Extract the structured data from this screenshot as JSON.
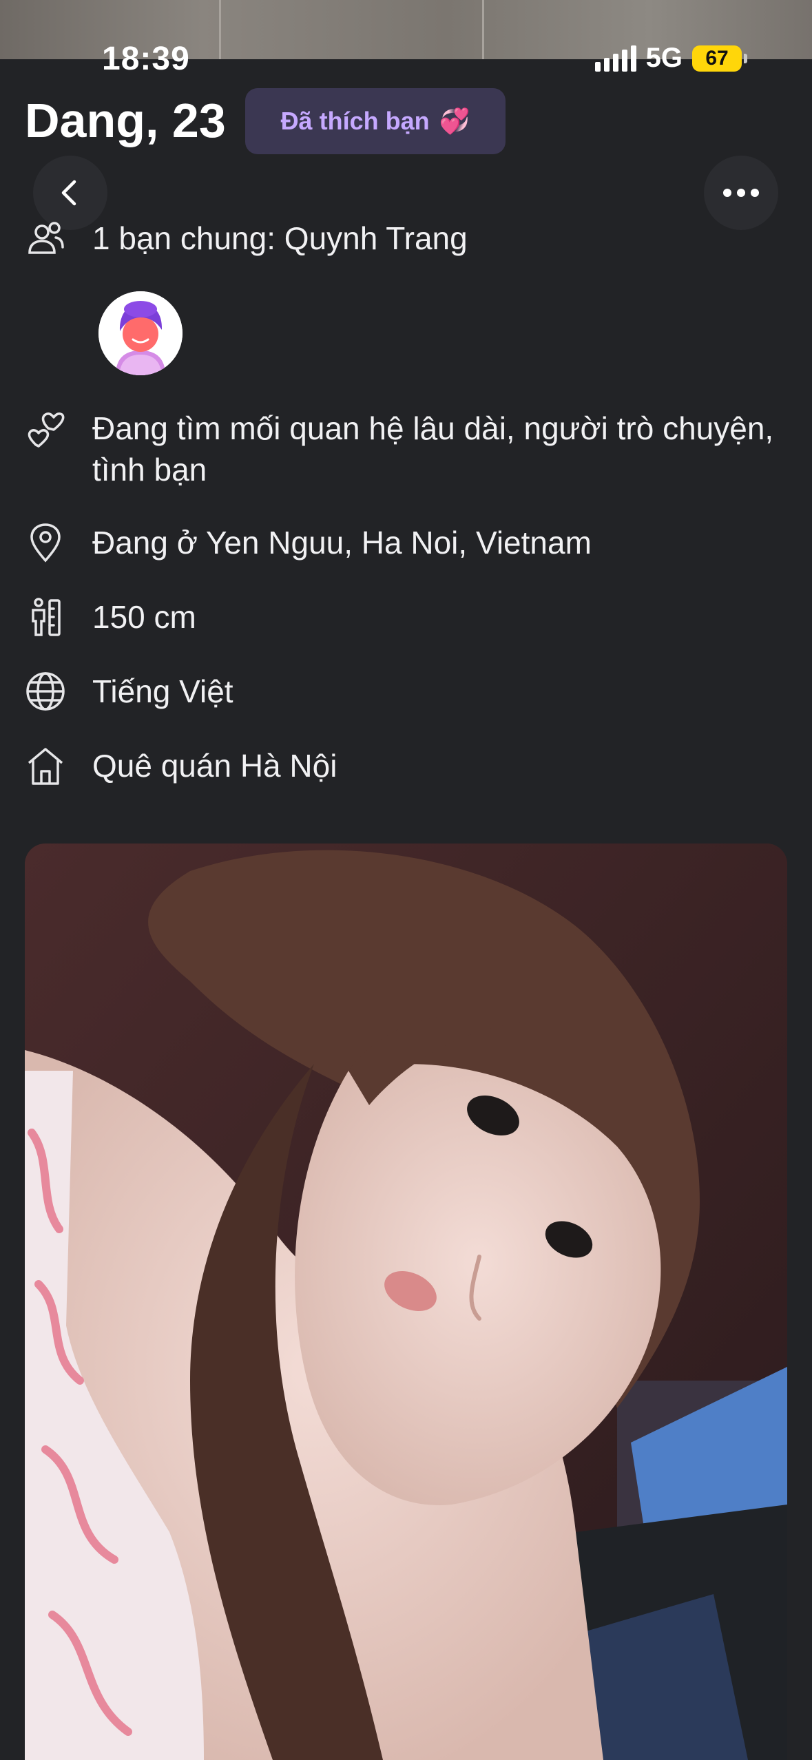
{
  "status_bar": {
    "time": "18:39",
    "network": "5G",
    "battery": "67"
  },
  "profile": {
    "name_age": "Dang, 23",
    "liked_badge": "Đã thích bạn",
    "liked_emoji": "💞"
  },
  "colors": {
    "background": "#222326",
    "badge_bg": "#3b3752",
    "badge_text": "#c6a9ff",
    "battery": "#ffd60a"
  },
  "details": {
    "mutual": {
      "icon": "people-icon",
      "text": "1 bạn chung: Quynh Trang"
    },
    "looking_for": {
      "icon": "hearts-icon",
      "text": "Đang tìm mối quan hệ lâu dài, người trò chuyện, tình bạn"
    },
    "location": {
      "icon": "location-pin-icon",
      "text": "Đang ở Yen Nguu, Ha Noi, Vietnam"
    },
    "height": {
      "icon": "height-icon",
      "text": "150 cm"
    },
    "language": {
      "icon": "globe-icon",
      "text": "Tiếng Việt"
    },
    "hometown": {
      "icon": "home-icon",
      "text": "Quê quán Hà Nội"
    }
  },
  "buttons": {
    "back_icon": "chevron-left-icon",
    "more_icon": "more-dots-icon"
  }
}
